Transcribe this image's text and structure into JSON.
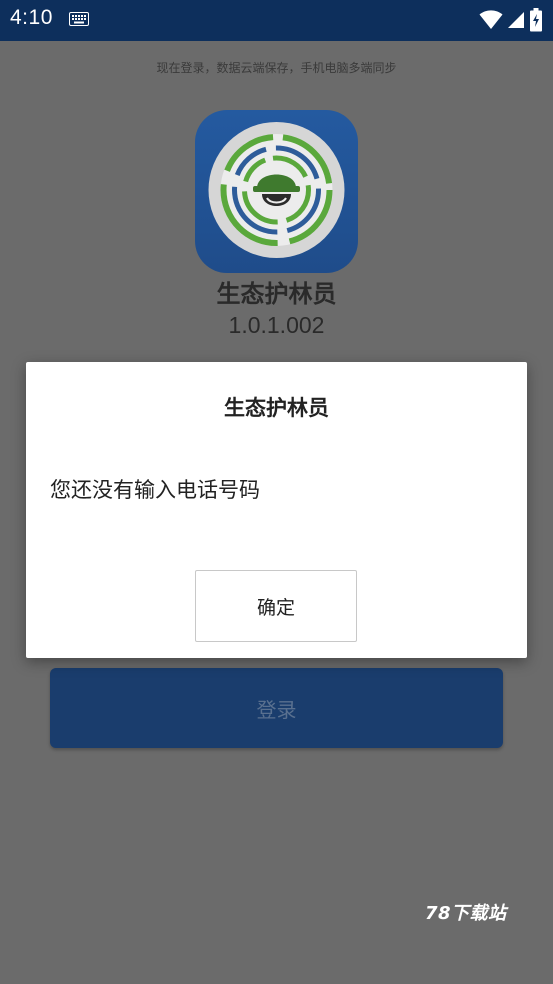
{
  "status_bar": {
    "time": "4:10",
    "icons": [
      "keyboard-icon",
      "wifi-icon",
      "signal-icon",
      "battery-icon"
    ]
  },
  "login_screen": {
    "hint": "现在登录，数据云端保存，手机电脑多端同步",
    "app_name": "生态护林员",
    "version": "1.0.1.002",
    "login_label": "登录"
  },
  "dialog": {
    "title": "生态护林员",
    "message": "您还没有输入电话号码",
    "ok_label": "确定"
  },
  "watermark": "78下载站",
  "colors": {
    "status_bar": "#0d2f5c",
    "overlay_background": "#6b6b6b",
    "login_button": "#1a3d6d",
    "logo_blue": "#245aa0",
    "logo_green": "#5aa83c"
  }
}
